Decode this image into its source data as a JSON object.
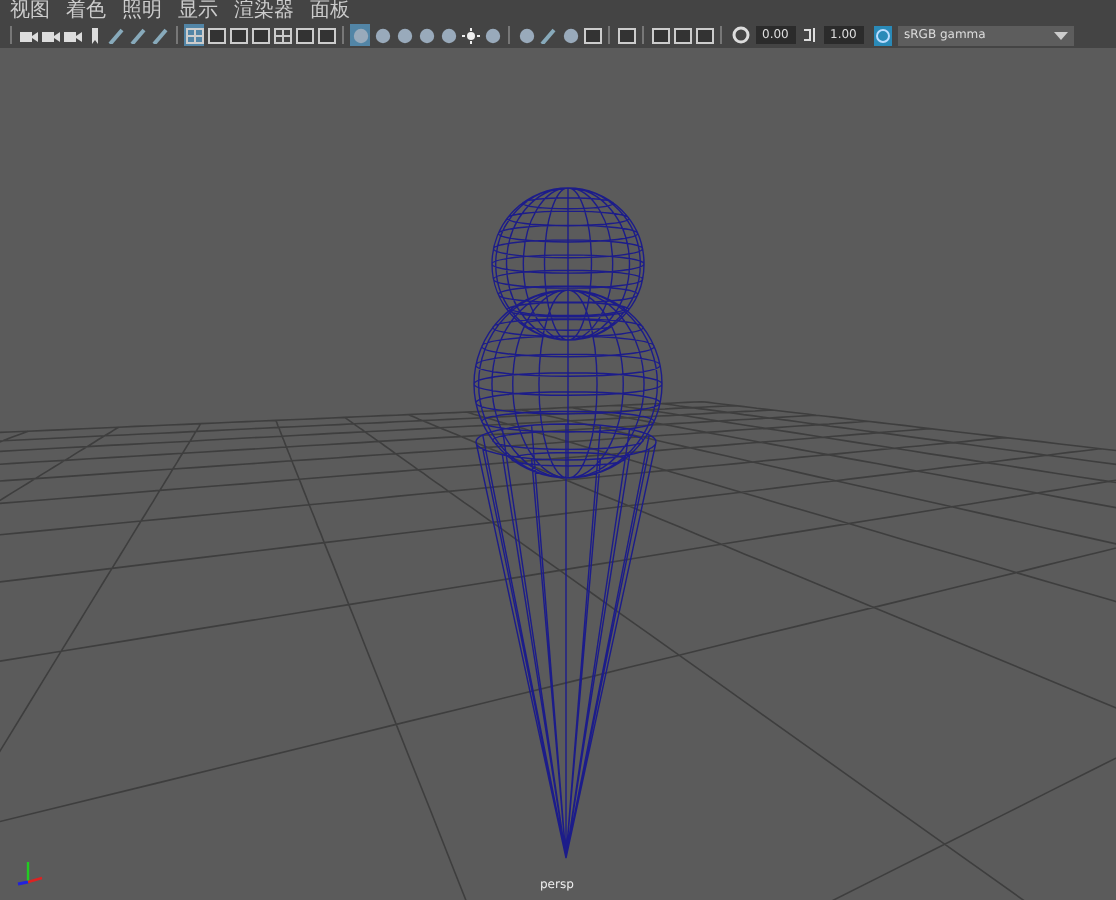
{
  "menu": [
    "视图",
    "着色",
    "照明",
    "显示",
    "渲染器",
    "面板"
  ],
  "toolbar": {
    "groups": [
      [
        {
          "kind": "camera",
          "selected": false
        },
        {
          "kind": "camera",
          "selected": false
        },
        {
          "kind": "camera",
          "selected": false
        },
        {
          "kind": "bookmark",
          "selected": false
        },
        {
          "kind": "pen",
          "selected": false
        },
        {
          "kind": "pen",
          "selected": false
        },
        {
          "kind": "pen",
          "selected": false
        }
      ],
      [
        {
          "kind": "grid",
          "selected": true
        },
        {
          "kind": "square",
          "selected": false
        },
        {
          "kind": "square",
          "selected": false
        },
        {
          "kind": "square",
          "selected": false
        },
        {
          "kind": "grid",
          "selected": false
        },
        {
          "kind": "square",
          "selected": false
        },
        {
          "kind": "square",
          "selected": false
        }
      ],
      [
        {
          "kind": "sphere",
          "selected": true
        },
        {
          "kind": "sphere",
          "selected": false
        },
        {
          "kind": "sphere",
          "selected": false
        },
        {
          "kind": "sphere",
          "selected": false
        },
        {
          "kind": "sphere",
          "selected": false
        },
        {
          "kind": "light",
          "selected": false
        },
        {
          "kind": "sphere",
          "selected": false
        }
      ],
      [
        {
          "kind": "sphere",
          "selected": false
        },
        {
          "kind": "pen",
          "selected": false
        },
        {
          "kind": "sphere",
          "selected": false
        },
        {
          "kind": "square",
          "selected": false
        }
      ],
      [
        {
          "kind": "square",
          "selected": false
        }
      ],
      [
        {
          "kind": "square",
          "selected": false
        },
        {
          "kind": "square",
          "selected": false
        },
        {
          "kind": "square",
          "selected": false
        }
      ]
    ],
    "exposure": "0.00",
    "gamma": "1.00",
    "color_space": "sRGB gamma"
  },
  "viewport": {
    "camera": "persp"
  }
}
